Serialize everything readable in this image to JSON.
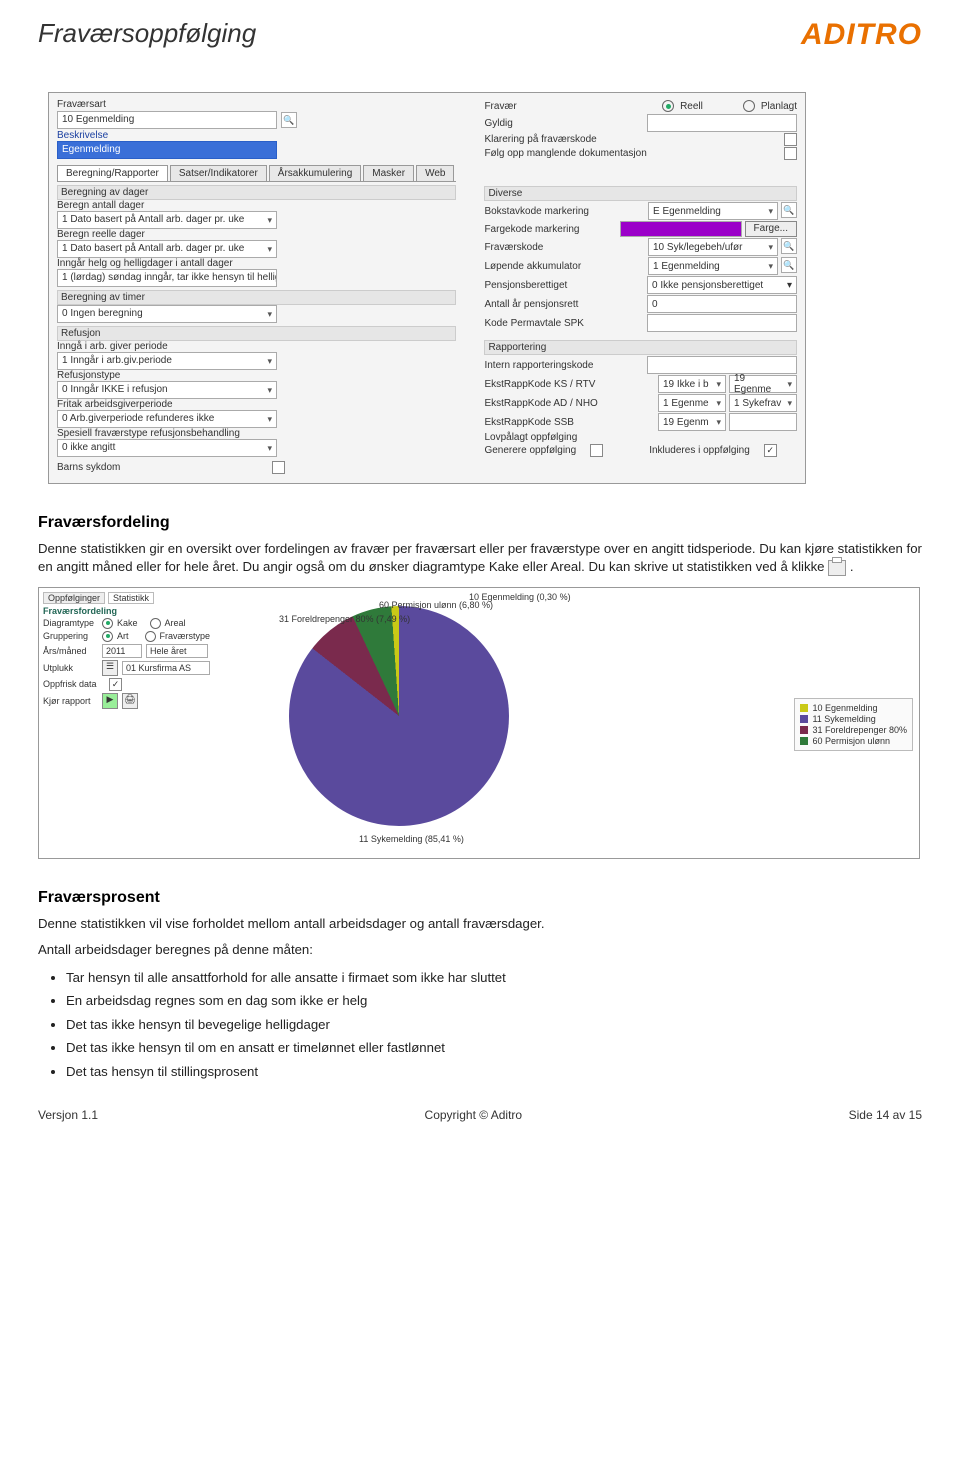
{
  "header": {
    "title": "Fraværsoppfølging",
    "logo": "ADITRO"
  },
  "shot1": {
    "left": {
      "fravarsart_label": "Fraværsart",
      "fravarsart_value": "10 Egenmelding",
      "beskrivelse_label": "Beskrivelse",
      "beskrivelse_value": "Egenmelding",
      "tabs": [
        "Beregning/Rapporter",
        "Satser/Indikatorer",
        "Årsakkumulering",
        "Masker",
        "Web"
      ],
      "sect1": "Beregning av dager",
      "beregn_antall_label": "Beregn antall dager",
      "beregn_antall_value": "1 Dato basert på Antall arb. dager pr. uke",
      "beregn_reelle_label": "Beregn reelle dager",
      "beregn_reelle_value": "1 Dato basert på Antall arb. dager pr. uke",
      "helg_label": "Inngår helg og helligdager i antall dager",
      "helg_value": "1 (lørdag) søndag inngår, tar ikke hensyn til hellig",
      "sect2": "Beregning av timer",
      "timer_value": "0 Ingen beregning",
      "sect3": "Refusjon",
      "inngar_arb_label": "Inngå i arb. giver periode",
      "inngar_arb_value": "1 Inngår i arb.giv.periode",
      "refusjonstype_label": "Refusjonstype",
      "refusjonstype_value": "0 Inngår IKKE i refusjon",
      "fritak_label": "Fritak arbeidsgiverperiode",
      "fritak_value": "0 Arb.giverperiode refunderes ikke",
      "spesiell_label": "Spesiell fraværstype refusjonsbehandling",
      "spesiell_value": "0 ikke angitt",
      "barns_label": "Barns sykdom"
    },
    "right": {
      "fravar_label": "Fravær",
      "reell": "Reell",
      "planlagt": "Planlagt",
      "gyldig_label": "Gyldig",
      "klar_label": "Klarering på fraværskode",
      "folg_label": "Følg opp manglende dokumentasjon",
      "sect_diverse": "Diverse",
      "bokstav_label": "Bokstavkode markering",
      "bokstav_value": "E Egenmelding",
      "fargekode_label": "Fargekode markering",
      "farge_btn": "Farge...",
      "fravarskode_label": "Fraværskode",
      "fravarskode_value": "10 Syk/legebeh/ufør",
      "lopende_label": "Løpende akkumulator",
      "lopende_value": "1 Egenmelding",
      "pensjons_label": "Pensjonsberettiget",
      "pensjons_value": "0 Ikke pensjonsberettiget",
      "antall_ar_label": "Antall år pensjonsrett",
      "antall_ar_value": "0",
      "kode_perm_label": "Kode Permavtale SPK",
      "sect_rapport": "Rapportering",
      "intern_label": "Intern rapporteringskode",
      "ks_label": "EkstRappKode  KS / RTV",
      "ks_v1": "19 Ikke i b",
      "ks_v2": "19 Egenme",
      "nho_label": "EkstRappKode  AD / NHO",
      "nho_v1": "1 Egenme",
      "nho_v2": "1 Sykefrav",
      "ssb_label": "EkstRappKode  SSB",
      "ssb_v1": "19 Egenm",
      "lov_label": "Lovpålagt oppfølging",
      "gen_label": "Generere oppfølging",
      "ink_label": "Inkluderes i oppfølging"
    }
  },
  "sec_fordeling": {
    "h": "Fraværsfordeling",
    "p1": "Denne statistikken gir en oversikt over fordelingen av fravær per fraværsart eller per fraværstype over en angitt tidsperiode. Du kan kjøre statistikken for en angitt måned eller for hele året. Du angir også om du ønsker diagramtype Kake eller Areal. Du kan skrive ut statistikken ved å klikke"
  },
  "chart_panel": {
    "tabs": [
      "Oppfølginger",
      "Statistikk"
    ],
    "title": "Fraværsfordeling",
    "diagramtype": "Diagramtype",
    "kake": "Kake",
    "areal": "Areal",
    "gruppering": "Gruppering",
    "art": "Art",
    "ftype": "Fraværstype",
    "arsmaned": "Års/måned",
    "year": "2011",
    "hele": "Hele året",
    "utplukk": "Utplukk",
    "utplukk_v": "01 Kursfirma AS",
    "oppfrisk": "Oppfrisk data",
    "kjor": "Kjør rapport"
  },
  "chart_data": {
    "type": "pie",
    "title": "Fraværsfordeling",
    "series": [
      {
        "name": "11 Sykemelding",
        "value": 85.41,
        "color": "#5a4a9d"
      },
      {
        "name": "31 Foreldrepenger 80%",
        "value": 7.49,
        "color": "#7a2a4d"
      },
      {
        "name": "60 Permisjon ulønn",
        "value": 6.8,
        "color": "#2f7a3a"
      },
      {
        "name": "10 Egenmelding",
        "value": 0.3,
        "color": "#c9c917"
      }
    ],
    "labels": {
      "l10": "10 Egenmelding (0,30 %)",
      "l60": "60 Permisjon ulønn (6,80 %)",
      "l31": "31 Foreldrepenger 80% (7,49 %)",
      "l11": "11 Sykemelding (85,41 %)"
    },
    "legend": [
      "10 Egenmelding",
      "11 Sykemelding",
      "31 Foreldrepenger 80%",
      "60 Permisjon ulønn"
    ]
  },
  "sec_prosent": {
    "h": "Fraværsprosent",
    "p1": "Denne statistikken vil vise forholdet mellom antall arbeidsdager og antall fraværsdager.",
    "p2": "Antall arbeidsdager beregnes på denne måten:",
    "bullets": [
      "Tar hensyn til alle ansattforhold for alle ansatte i firmaet som ikke har sluttet",
      "En arbeidsdag regnes som en dag som ikke er helg",
      "Det tas ikke hensyn til bevegelige helligdager",
      "Det tas ikke hensyn til om en ansatt er timelønnet eller fastlønnet",
      "Det tas hensyn til stillingsprosent"
    ]
  },
  "footer": {
    "left": "Versjon 1.1",
    "center": "Copyright © Aditro",
    "right": "Side 14 av 15"
  }
}
